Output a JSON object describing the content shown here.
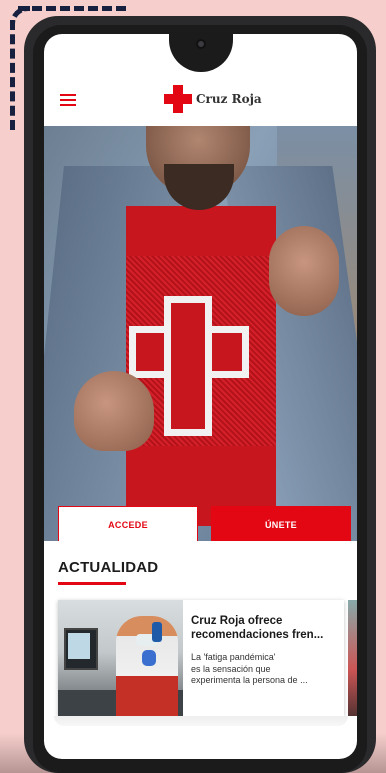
{
  "header": {
    "menu_icon": "hamburger-menu-icon",
    "logo_icon": "red-cross-icon",
    "logo_text": "Cruz Roja",
    "brand_color": "#e30613"
  },
  "hero": {
    "accede_label": "ACCEDE",
    "unete_label": "ÚNETE"
  },
  "actualidad": {
    "title": "ACTUALIDAD",
    "cards": [
      {
        "title_line1": "Cruz Roja ofrece",
        "title_line2": "recomendaciones fren...",
        "text_line1": "La 'fatiga pandémica'",
        "text_line2": "es la sensación que",
        "text_line3": "experimenta la persona de ..."
      }
    ]
  }
}
